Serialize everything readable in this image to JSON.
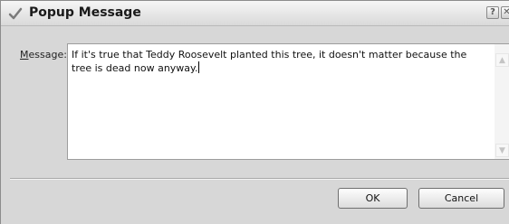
{
  "window": {
    "title": "Popup Message",
    "icon": "checkmark-icon",
    "help_glyph": "?",
    "close_glyph": "✕"
  },
  "form": {
    "message_label_accesskey": "M",
    "message_label_rest": "essage:",
    "message_text": "If it's true that Teddy Roosevelt planted this tree, it doesn't matter because the tree is dead now anyway."
  },
  "scrollbar": {
    "up_glyph": "▲",
    "down_glyph": "▼"
  },
  "buttons": {
    "ok_label": "OK",
    "cancel_label": "Cancel"
  }
}
